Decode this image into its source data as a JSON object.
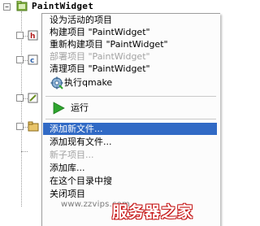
{
  "tree": {
    "root_label": "PaintWidget",
    "expander_symbol": "−"
  },
  "menu": {
    "items": [
      {
        "label": "设为活动的项目",
        "disabled": false
      },
      {
        "label": "构建项目 \"PaintWidget\"",
        "disabled": false
      },
      {
        "label": "重新构建项目 \"PaintWidget\"",
        "disabled": false
      },
      {
        "label": "部署项目 \"PaintWidget\"",
        "disabled": true
      },
      {
        "label": "清理项目 \"PaintWidget\"",
        "disabled": false
      },
      {
        "label": "执行qmake",
        "disabled": false,
        "icon": "qmake-gear-icon"
      },
      {
        "label": "运行",
        "disabled": false,
        "icon": "run-play-icon"
      },
      {
        "label": "添加新文件...",
        "disabled": false,
        "highlighted": true
      },
      {
        "label": "添加现有文件...",
        "disabled": false
      },
      {
        "label": "新子项目...",
        "disabled": true
      },
      {
        "label": "添加库...",
        "disabled": false
      },
      {
        "label": "在这个目录中搜",
        "disabled": false
      },
      {
        "label": "关闭项目",
        "disabled": false
      }
    ]
  },
  "watermark": {
    "url": "www.zzvips.com",
    "brand": "服务器之家"
  },
  "colors": {
    "highlight": "#316ac5",
    "disabled_text": "#a3a3a3",
    "run_icon": "#2fa52f",
    "watermark_red": "#c21a1a"
  }
}
